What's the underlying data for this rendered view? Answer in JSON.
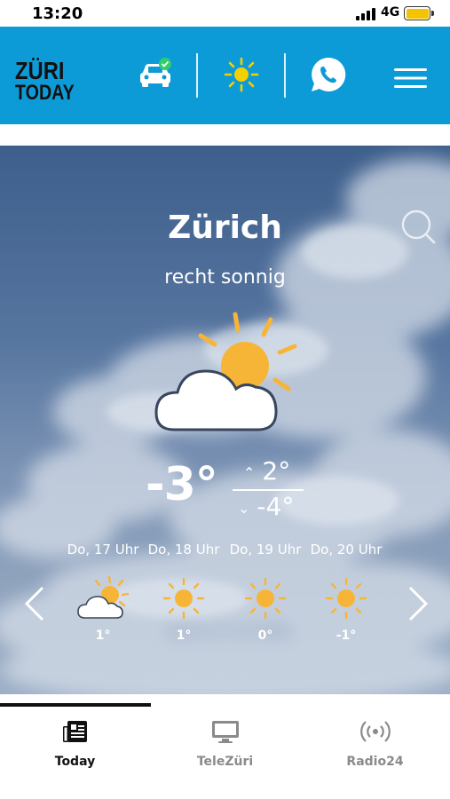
{
  "status_bar": {
    "time": "13:20",
    "network": "4G"
  },
  "header": {
    "logo_line1": "ZÜRI",
    "logo_line2": "TODAY",
    "icons": [
      "traffic-car-icon",
      "weather-sun-icon",
      "whatsapp-icon",
      "hamburger-menu-icon"
    ]
  },
  "weather": {
    "city": "Zürich",
    "condition": "recht sonnig",
    "current_temp": "-3°",
    "high": "2°",
    "low": "-4°",
    "current_icon": "sun-behind-cloud-icon",
    "hourly": [
      {
        "label": "Do, 17 Uhr",
        "temp": "1°",
        "icon": "sun-behind-cloud-icon"
      },
      {
        "label": "Do, 18 Uhr",
        "temp": "1°",
        "icon": "sun-icon"
      },
      {
        "label": "Do, 19 Uhr",
        "temp": "0°",
        "icon": "sun-icon"
      },
      {
        "label": "Do, 20 Uhr",
        "temp": "-1°",
        "icon": "sun-icon"
      }
    ]
  },
  "bottom_nav": {
    "tabs": [
      {
        "label": "Today",
        "active": true,
        "icon": "newspaper-icon"
      },
      {
        "label": "TeleZüri",
        "active": false,
        "icon": "tv-icon"
      },
      {
        "label": "Radio24",
        "active": false,
        "icon": "radio-broadcast-icon"
      }
    ]
  },
  "colors": {
    "header_bg": "#0d9bd8",
    "sun": "#f7b538",
    "battery": "#f5c400",
    "active_tab": "#111111",
    "inactive_tab": "#8a8a8a"
  }
}
